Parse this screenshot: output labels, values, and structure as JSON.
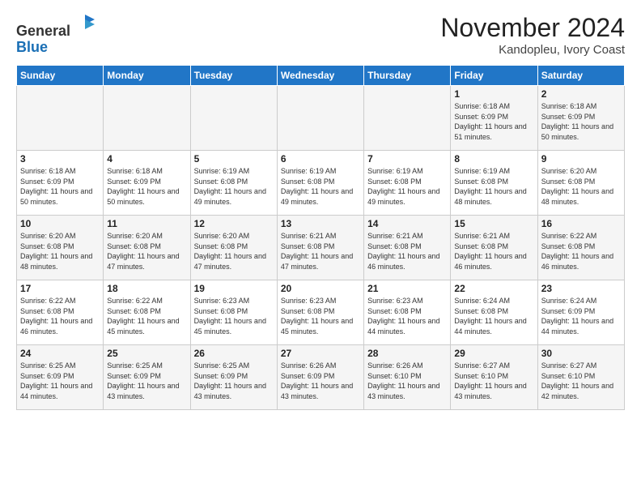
{
  "header": {
    "logo_line1": "General",
    "logo_line2": "Blue",
    "month_title": "November 2024",
    "location": "Kandopleu, Ivory Coast"
  },
  "days_of_week": [
    "Sunday",
    "Monday",
    "Tuesday",
    "Wednesday",
    "Thursday",
    "Friday",
    "Saturday"
  ],
  "weeks": [
    [
      {
        "day": "",
        "info": ""
      },
      {
        "day": "",
        "info": ""
      },
      {
        "day": "",
        "info": ""
      },
      {
        "day": "",
        "info": ""
      },
      {
        "day": "",
        "info": ""
      },
      {
        "day": "1",
        "info": "Sunrise: 6:18 AM\nSunset: 6:09 PM\nDaylight: 11 hours and 51 minutes."
      },
      {
        "day": "2",
        "info": "Sunrise: 6:18 AM\nSunset: 6:09 PM\nDaylight: 11 hours and 50 minutes."
      }
    ],
    [
      {
        "day": "3",
        "info": "Sunrise: 6:18 AM\nSunset: 6:09 PM\nDaylight: 11 hours and 50 minutes."
      },
      {
        "day": "4",
        "info": "Sunrise: 6:18 AM\nSunset: 6:09 PM\nDaylight: 11 hours and 50 minutes."
      },
      {
        "day": "5",
        "info": "Sunrise: 6:19 AM\nSunset: 6:08 PM\nDaylight: 11 hours and 49 minutes."
      },
      {
        "day": "6",
        "info": "Sunrise: 6:19 AM\nSunset: 6:08 PM\nDaylight: 11 hours and 49 minutes."
      },
      {
        "day": "7",
        "info": "Sunrise: 6:19 AM\nSunset: 6:08 PM\nDaylight: 11 hours and 49 minutes."
      },
      {
        "day": "8",
        "info": "Sunrise: 6:19 AM\nSunset: 6:08 PM\nDaylight: 11 hours and 48 minutes."
      },
      {
        "day": "9",
        "info": "Sunrise: 6:20 AM\nSunset: 6:08 PM\nDaylight: 11 hours and 48 minutes."
      }
    ],
    [
      {
        "day": "10",
        "info": "Sunrise: 6:20 AM\nSunset: 6:08 PM\nDaylight: 11 hours and 48 minutes."
      },
      {
        "day": "11",
        "info": "Sunrise: 6:20 AM\nSunset: 6:08 PM\nDaylight: 11 hours and 47 minutes."
      },
      {
        "day": "12",
        "info": "Sunrise: 6:20 AM\nSunset: 6:08 PM\nDaylight: 11 hours and 47 minutes."
      },
      {
        "day": "13",
        "info": "Sunrise: 6:21 AM\nSunset: 6:08 PM\nDaylight: 11 hours and 47 minutes."
      },
      {
        "day": "14",
        "info": "Sunrise: 6:21 AM\nSunset: 6:08 PM\nDaylight: 11 hours and 46 minutes."
      },
      {
        "day": "15",
        "info": "Sunrise: 6:21 AM\nSunset: 6:08 PM\nDaylight: 11 hours and 46 minutes."
      },
      {
        "day": "16",
        "info": "Sunrise: 6:22 AM\nSunset: 6:08 PM\nDaylight: 11 hours and 46 minutes."
      }
    ],
    [
      {
        "day": "17",
        "info": "Sunrise: 6:22 AM\nSunset: 6:08 PM\nDaylight: 11 hours and 46 minutes."
      },
      {
        "day": "18",
        "info": "Sunrise: 6:22 AM\nSunset: 6:08 PM\nDaylight: 11 hours and 45 minutes."
      },
      {
        "day": "19",
        "info": "Sunrise: 6:23 AM\nSunset: 6:08 PM\nDaylight: 11 hours and 45 minutes."
      },
      {
        "day": "20",
        "info": "Sunrise: 6:23 AM\nSunset: 6:08 PM\nDaylight: 11 hours and 45 minutes."
      },
      {
        "day": "21",
        "info": "Sunrise: 6:23 AM\nSunset: 6:08 PM\nDaylight: 11 hours and 44 minutes."
      },
      {
        "day": "22",
        "info": "Sunrise: 6:24 AM\nSunset: 6:08 PM\nDaylight: 11 hours and 44 minutes."
      },
      {
        "day": "23",
        "info": "Sunrise: 6:24 AM\nSunset: 6:09 PM\nDaylight: 11 hours and 44 minutes."
      }
    ],
    [
      {
        "day": "24",
        "info": "Sunrise: 6:25 AM\nSunset: 6:09 PM\nDaylight: 11 hours and 44 minutes."
      },
      {
        "day": "25",
        "info": "Sunrise: 6:25 AM\nSunset: 6:09 PM\nDaylight: 11 hours and 43 minutes."
      },
      {
        "day": "26",
        "info": "Sunrise: 6:25 AM\nSunset: 6:09 PM\nDaylight: 11 hours and 43 minutes."
      },
      {
        "day": "27",
        "info": "Sunrise: 6:26 AM\nSunset: 6:09 PM\nDaylight: 11 hours and 43 minutes."
      },
      {
        "day": "28",
        "info": "Sunrise: 6:26 AM\nSunset: 6:10 PM\nDaylight: 11 hours and 43 minutes."
      },
      {
        "day": "29",
        "info": "Sunrise: 6:27 AM\nSunset: 6:10 PM\nDaylight: 11 hours and 43 minutes."
      },
      {
        "day": "30",
        "info": "Sunrise: 6:27 AM\nSunset: 6:10 PM\nDaylight: 11 hours and 42 minutes."
      }
    ]
  ]
}
